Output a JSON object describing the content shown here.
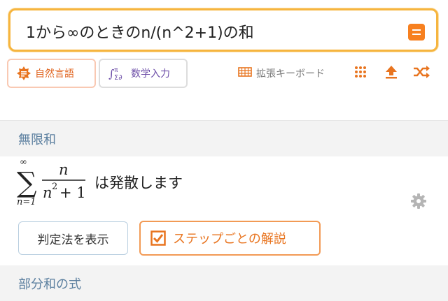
{
  "search": {
    "query": "1から∞のときのn/(n^2+1)の和"
  },
  "modes": {
    "natural_label": "自然言語",
    "math_label": "数学入力"
  },
  "tools": {
    "keyboard_label": "拡張キーボード"
  },
  "result": {
    "section_title": "無限和",
    "sum_upper": "∞",
    "sum_lower": "n=1",
    "numerator": "n",
    "denominator": "n",
    "exponent": "2",
    "denominator_rest": "+ 1",
    "text": "は発散します"
  },
  "buttons": {
    "test_label": "判定法を表示",
    "steps_label": "ステップごとの解説"
  },
  "partial": {
    "section_title": "部分和の式"
  },
  "colors": {
    "accent": "#f7801f",
    "search_border": "#f6b53f",
    "section_text": "#5b7f9f",
    "math_purple": "#6d4ea8"
  },
  "icons": [
    "equals-icon",
    "natural-language-icon",
    "math-input-icon",
    "keyboard-icon",
    "grid-icon",
    "upload-icon",
    "shuffle-icon",
    "gear-icon",
    "checkbox-icon"
  ]
}
